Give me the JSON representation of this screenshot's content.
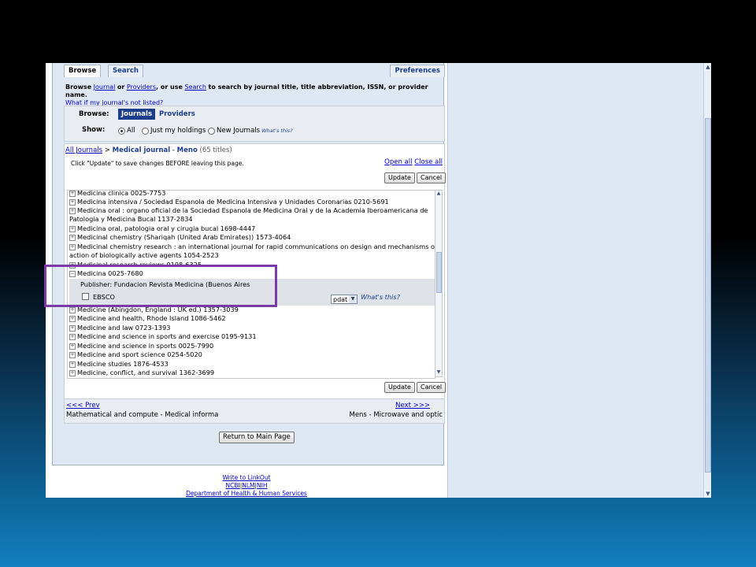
{
  "colors": {
    "highlight": "#7a3aa8",
    "accent": "#1b3e8c",
    "link": "#0000cc"
  },
  "tabs": {
    "browse": "Browse",
    "search": "Search",
    "preferences": "Preferences"
  },
  "intro": {
    "browse": "Browse",
    "journal": "Journal",
    "or": "or",
    "providers": "Providers",
    "or_use": ", or use",
    "search": "Search",
    "rest": "to search by journal title, title abbreviation, ISSN, or provider name.",
    "not_listed": "What if my journal's not listed?"
  },
  "filter": {
    "browse_label": "Browse:",
    "journals": "Journals",
    "providers": "Providers",
    "show_label": "Show:",
    "all": "All",
    "holdings": "Just my holdings",
    "new": "New Journals",
    "whats_this": "What's this?"
  },
  "breadcrumb": {
    "all": "All Journals",
    "sep": ">",
    "medical": "Medical journal",
    "dash": "-",
    "meno": "Meno",
    "count": "(65 titles)"
  },
  "hint": "Click \"Update\" to save changes BEFORE leaving this page.",
  "open_all": "Open all",
  "close_all": "Close all",
  "buttons": {
    "update": "Update",
    "cancel": "Cancel",
    "return": "Return to Main Page"
  },
  "list_top": [
    "Medicina clinica 0025-7753",
    "Medicina intensiva / Sociedad Espanola de Medicina Intensiva y Unidades Coronarias 0210-5691",
    "Medicina oral : organo oficial de la Sociedad Espanola de Medicina Oral y de la Academia Iberoamericana de",
    "Patologia y Medicina Bucal 1137-2834",
    "Medicina oral, patologia oral y cirugia bucal 1698-4447",
    "Medicinal chemistry (Shariqah (United Arab Emirates)) 1573-4064",
    "Medicinal chemistry research : an international journal for rapid communications on design and mechanisms of",
    "action of biologically active agents 1054-2523",
    "Medicinal research reviews 0198-6325"
  ],
  "expanded": {
    "title": "Medicina 0025-7680",
    "publisher": "Publisher: Fundacion Revista Medicina (Buenos Aires",
    "provider": "EBSCO",
    "format": "pdat",
    "whats_this": "What's this?"
  },
  "list_bottom": [
    "Medicine (Abingdon, England : UK ed.) 1357-3039",
    "Medicine and health, Rhode Island 1086-5462",
    "Medicine and law 0723-1393",
    "Medicine and science in sports and exercise 0195-9131",
    "Medicine and science in sports 0025-7990",
    "Medicine and sport science 0254-5020",
    "Medicine studies 1876-4533",
    "Medicine, conflict, and survival 1362-3699"
  ],
  "nav": {
    "prev": "<<< Prev",
    "next": "Next >>>",
    "prev_range": "Mathematical and compute - Medical informa",
    "next_range": "Mens - Microwave and optic"
  },
  "footer": {
    "write": "Write to LinkOut",
    "ncbi": "NCBI",
    "nlm": "NLM",
    "nih": "NIH",
    "sep": "|",
    "dept": "Department of Health & Human Services"
  }
}
